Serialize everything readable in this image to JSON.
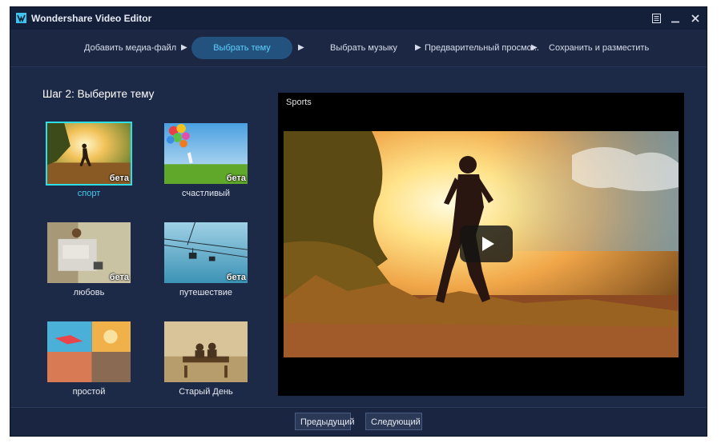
{
  "window": {
    "title": "Wondershare Video Editor",
    "icons": [
      "app-logo-icon",
      "menu-icon",
      "minimize-icon",
      "close-icon"
    ]
  },
  "steps": {
    "items": [
      {
        "label": "Добавить медиа-файл",
        "active": false
      },
      {
        "label": "Выбрать тему",
        "active": true
      },
      {
        "label": "Выбрать музыку",
        "active": false
      },
      {
        "label": "Предварительный просмо...",
        "active": false
      },
      {
        "label": "Сохранить и разместить",
        "active": false
      }
    ],
    "arrow": "▶"
  },
  "heading": "Шаг 2: Выберите тему",
  "themes": [
    {
      "label": "спорт",
      "badge": "бета",
      "selected": true
    },
    {
      "label": "счастливый",
      "badge": "бета",
      "selected": false
    },
    {
      "label": "любовь",
      "badge": "бета",
      "selected": false
    },
    {
      "label": "путешествие",
      "badge": "бета",
      "selected": false
    },
    {
      "label": "простой",
      "badge": "",
      "selected": false
    },
    {
      "label": "Старый День",
      "badge": "",
      "selected": false
    }
  ],
  "preview": {
    "title": "Sports",
    "play_icon": "play-icon"
  },
  "footer": {
    "prev_label": "Предыдущий",
    "next_label": "Следующий"
  },
  "colors": {
    "window_bg": "#1d2a47",
    "titlebar_bg": "#14203a",
    "active_step_bg": "#23527e",
    "active_step_text": "#5fd0ff",
    "selected_border": "#2ee0e6",
    "selected_label": "#42c9ef"
  }
}
